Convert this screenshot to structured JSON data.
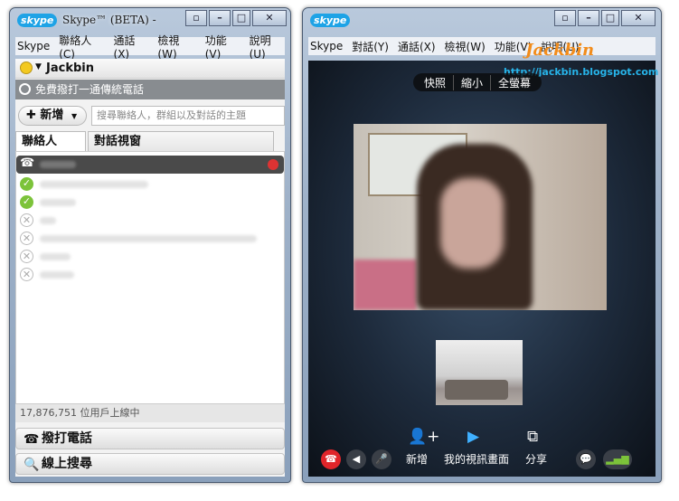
{
  "left_window": {
    "logo": "skype",
    "title": "Skype™ (BETA) -",
    "menu": [
      "Skype",
      "聯絡人(C)",
      "通話(X)",
      "檢視(W)",
      "功能(V)",
      "說明(U)"
    ],
    "user_name": "Jackbin",
    "promo": "免費撥打一通傳統電話",
    "add_button": "新增",
    "search_placeholder": "搜尋聯絡人，群組以及對話的主題",
    "tabs": [
      "聯絡人",
      "對話視窗"
    ],
    "online_count": "17,876,751 位用戶上線中",
    "call_button": "撥打電話",
    "search_online_button": "線上搜尋"
  },
  "right_window": {
    "logo": "skype",
    "menu": [
      "Skype",
      "對話(Y)",
      "通話(X)",
      "檢視(W)",
      "功能(V)",
      "說明(U)"
    ],
    "watermark_brand": "Jackbin",
    "watermark_url": "http://jackbin.blogspot.com",
    "zoom_buttons": [
      "快照",
      "縮小",
      "全螢幕"
    ],
    "add_label": "新增",
    "my_video_label": "我的視訊畫面",
    "share_label": "分享"
  },
  "colors": {
    "accent": "#1ea3e6",
    "hangup": "#e0252a",
    "online": "#7cc33a"
  },
  "icons": [
    "skype-logo-icon",
    "minimize-icon",
    "maximize-icon",
    "close-icon",
    "status-icon",
    "phone-icon",
    "add-icon",
    "hangup-icon",
    "speaker-icon",
    "mute-icon",
    "add-person-icon",
    "video-camera-icon",
    "share-icon",
    "chat-icon",
    "signal-icon",
    "search-icon"
  ]
}
